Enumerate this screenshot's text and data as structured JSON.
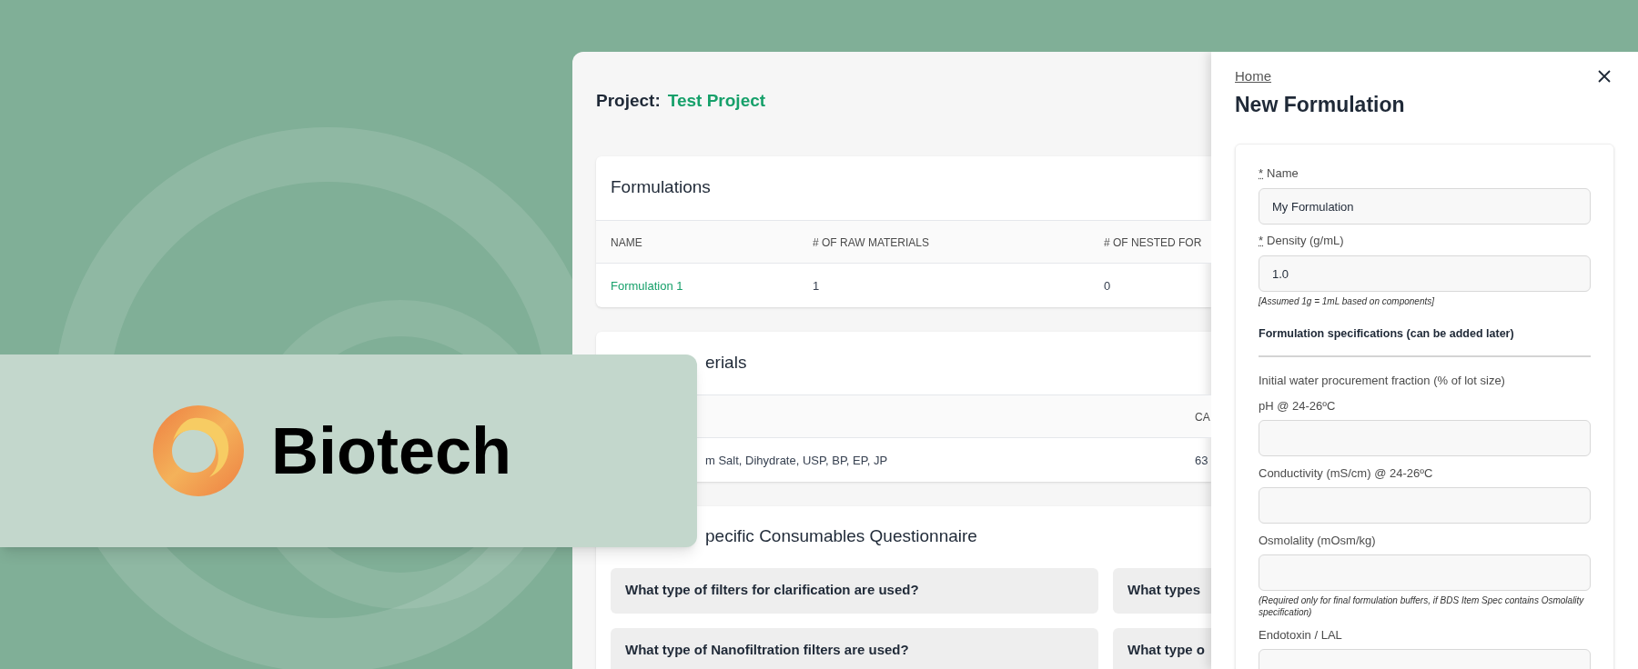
{
  "brand": {
    "name": "Biotech"
  },
  "project": {
    "label": "Project:",
    "name": "Test Project"
  },
  "formulations": {
    "title": "Formulations",
    "columns": [
      "NAME",
      "# OF RAW MATERIALS",
      "# OF NESTED FOR"
    ],
    "rows": [
      {
        "cells": [
          "Formulation 1",
          "1",
          "0"
        ]
      }
    ]
  },
  "raw_materials": {
    "title": "erials",
    "columns": [
      "",
      "CA"
    ],
    "rows": [
      {
        "cells": [
          "m Salt, Dihydrate, USP, BP, EP, JP",
          "63"
        ]
      }
    ]
  },
  "questionnaire": {
    "title": "pecific Consumables Questionnaire",
    "questions": [
      "What type of filters for clarification are used?",
      "What types",
      "What type of Nanofiltration filters are used?",
      "What type o"
    ]
  },
  "drawer": {
    "breadcrumb": "Home",
    "title": "New Formulation",
    "fields": [
      {
        "kind": "field",
        "required_mark": "*",
        "label": "Name",
        "value": "My Formulation"
      },
      {
        "kind": "field",
        "required_mark": "*",
        "label": "Density (g/mL)",
        "value": "1.0",
        "hint": "[Assumed 1g = 1mL based on components]"
      },
      {
        "kind": "heading",
        "label": "Formulation specifications (can be added later)"
      },
      {
        "kind": "label",
        "label": "Initial water procurement fraction (% of lot size)"
      },
      {
        "kind": "field",
        "label": "pH @ 24-26ºC"
      },
      {
        "kind": "field",
        "label": "Conductivity (mS/cm) @ 24-26ºC"
      },
      {
        "kind": "field",
        "label": "Osmolality (mOsm/kg)",
        "hint": "(Required only for final formulation buffers, if BDS Item Spec contains Osmolality specification)"
      },
      {
        "kind": "field",
        "label": "Endotoxin / LAL"
      }
    ]
  }
}
